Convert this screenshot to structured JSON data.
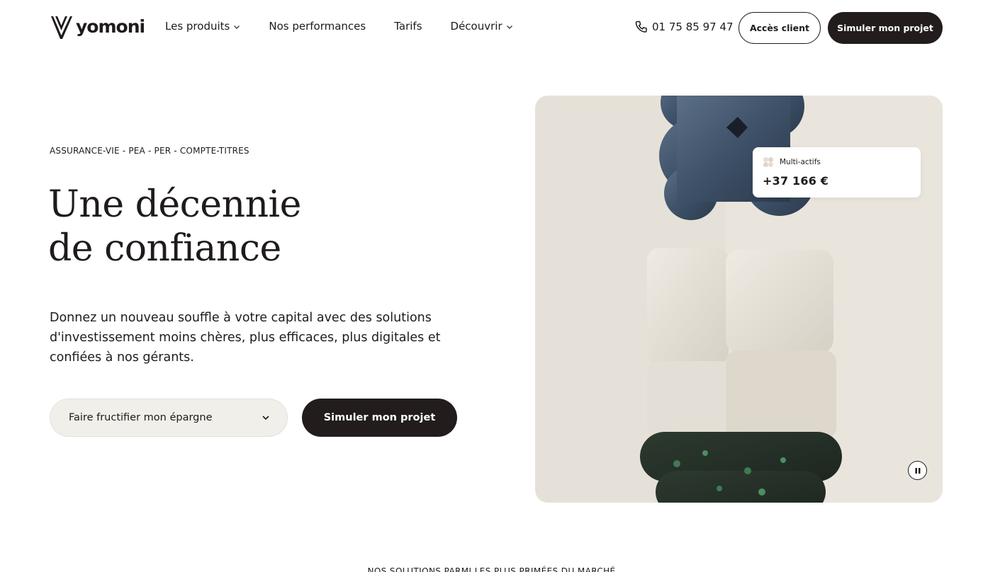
{
  "header": {
    "logo_text": "yomoni",
    "nav": [
      {
        "label": "Les produits",
        "has_dropdown": true
      },
      {
        "label": "Nos performances",
        "has_dropdown": false
      },
      {
        "label": "Tarifs",
        "has_dropdown": false
      },
      {
        "label": "Découvrir",
        "has_dropdown": true
      }
    ],
    "phone": "01 75 85 97 47",
    "access_label": "Accès client",
    "simulate_label": "Simuler mon projet"
  },
  "hero": {
    "eyebrow": "ASSURANCE-VIE - PEA - PER - COMPTE-TITRES",
    "title_line1": "Une décennie",
    "title_line2": "de confiance",
    "lead": "Donnez un nouveau souffle à votre capital avec des solutions d'investissement moins chères, plus efficaces, plus digitales et confiées à nos gérants.",
    "select_value": "Faire fructifier mon épargne",
    "cta_label": "Simuler mon projet",
    "card": {
      "label": "Multi-actifs",
      "value": "+37 166 €"
    }
  },
  "bottom_caption": "NOS SOLUTIONS PARMI LES PLUS PRIMÉES DU MARCHÉ",
  "colors": {
    "dark": "#221d1c",
    "select_bg": "#f1efe9",
    "image_bg": "#e6e1d8"
  },
  "icons": [
    "logo-mark-icon",
    "chevron-down-icon",
    "phone-icon",
    "multi-assets-icon",
    "pause-icon"
  ]
}
